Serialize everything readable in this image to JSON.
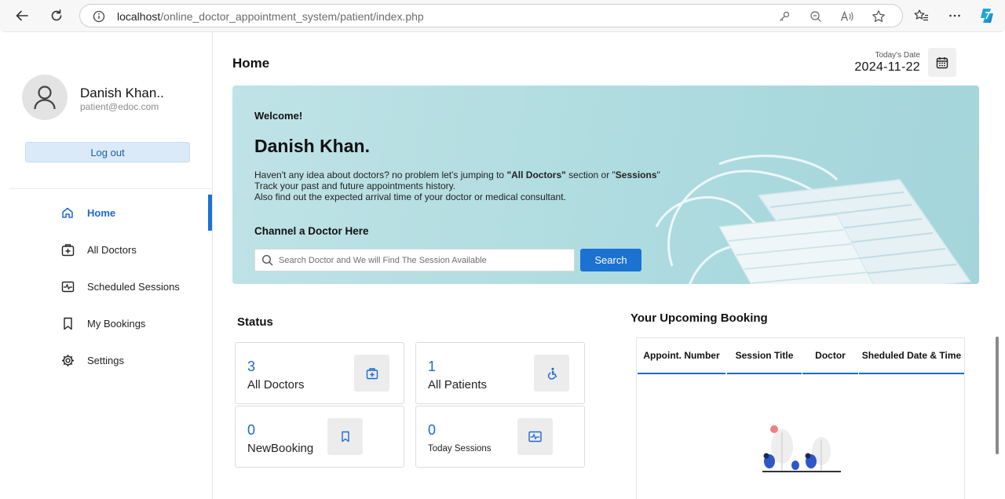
{
  "browser": {
    "url_host": "localhost",
    "url_path": "/online_doctor_appointment_system/patient/index.php"
  },
  "sidebar": {
    "profile_name": "Danish Khan..",
    "profile_email": "patient@edoc.com",
    "logout_label": "Log out",
    "items": [
      {
        "label": "Home",
        "icon": "home-icon",
        "active": true
      },
      {
        "label": "All Doctors",
        "icon": "medical-bag-icon",
        "active": false
      },
      {
        "label": "Scheduled Sessions",
        "icon": "pulse-icon",
        "active": false
      },
      {
        "label": "My Bookings",
        "icon": "bookmark-icon",
        "active": false
      },
      {
        "label": "Settings",
        "icon": "gear-icon",
        "active": false
      }
    ]
  },
  "header": {
    "title": "Home",
    "date_label": "Today's Date",
    "date_value": "2024-11-22"
  },
  "banner": {
    "welcome": "Welcome!",
    "name": "Danish Khan.",
    "desc_line1_pre": "Haven't any idea about doctors? no problem let's jumping to ",
    "desc_line1_bold1": "\"All Doctors\"",
    "desc_line1_mid": " section or \"",
    "desc_line1_bold2": "Sessions",
    "desc_line1_post": "\"",
    "desc_line2": "Track your past and future appointments history.",
    "desc_line3": "Also find out the expected arrival time of your doctor or medical consultant.",
    "channel_title": "Channel a Doctor Here",
    "search_placeholder": "Search Doctor and We will Find The Session Available",
    "search_button": "Search"
  },
  "status": {
    "title": "Status",
    "cards": [
      {
        "value": "3",
        "label": "All Doctors",
        "icon": "medical-bag-icon"
      },
      {
        "value": "1",
        "label": "All Patients",
        "icon": "wheelchair-icon"
      },
      {
        "value": "0",
        "label": "NewBooking",
        "icon": "bookmark-icon"
      },
      {
        "value": "0",
        "label": "Today Sessions",
        "icon": "pulse-icon"
      }
    ]
  },
  "upcoming": {
    "title": "Your Upcoming Booking",
    "columns": [
      "Appoint. Number",
      "Session Title",
      "Doctor",
      "Sheduled Date & Time"
    ]
  },
  "colors": {
    "accent": "#1a6ad0",
    "banner_bg": "#aedbdf",
    "logout_bg": "#dbeaf8"
  }
}
